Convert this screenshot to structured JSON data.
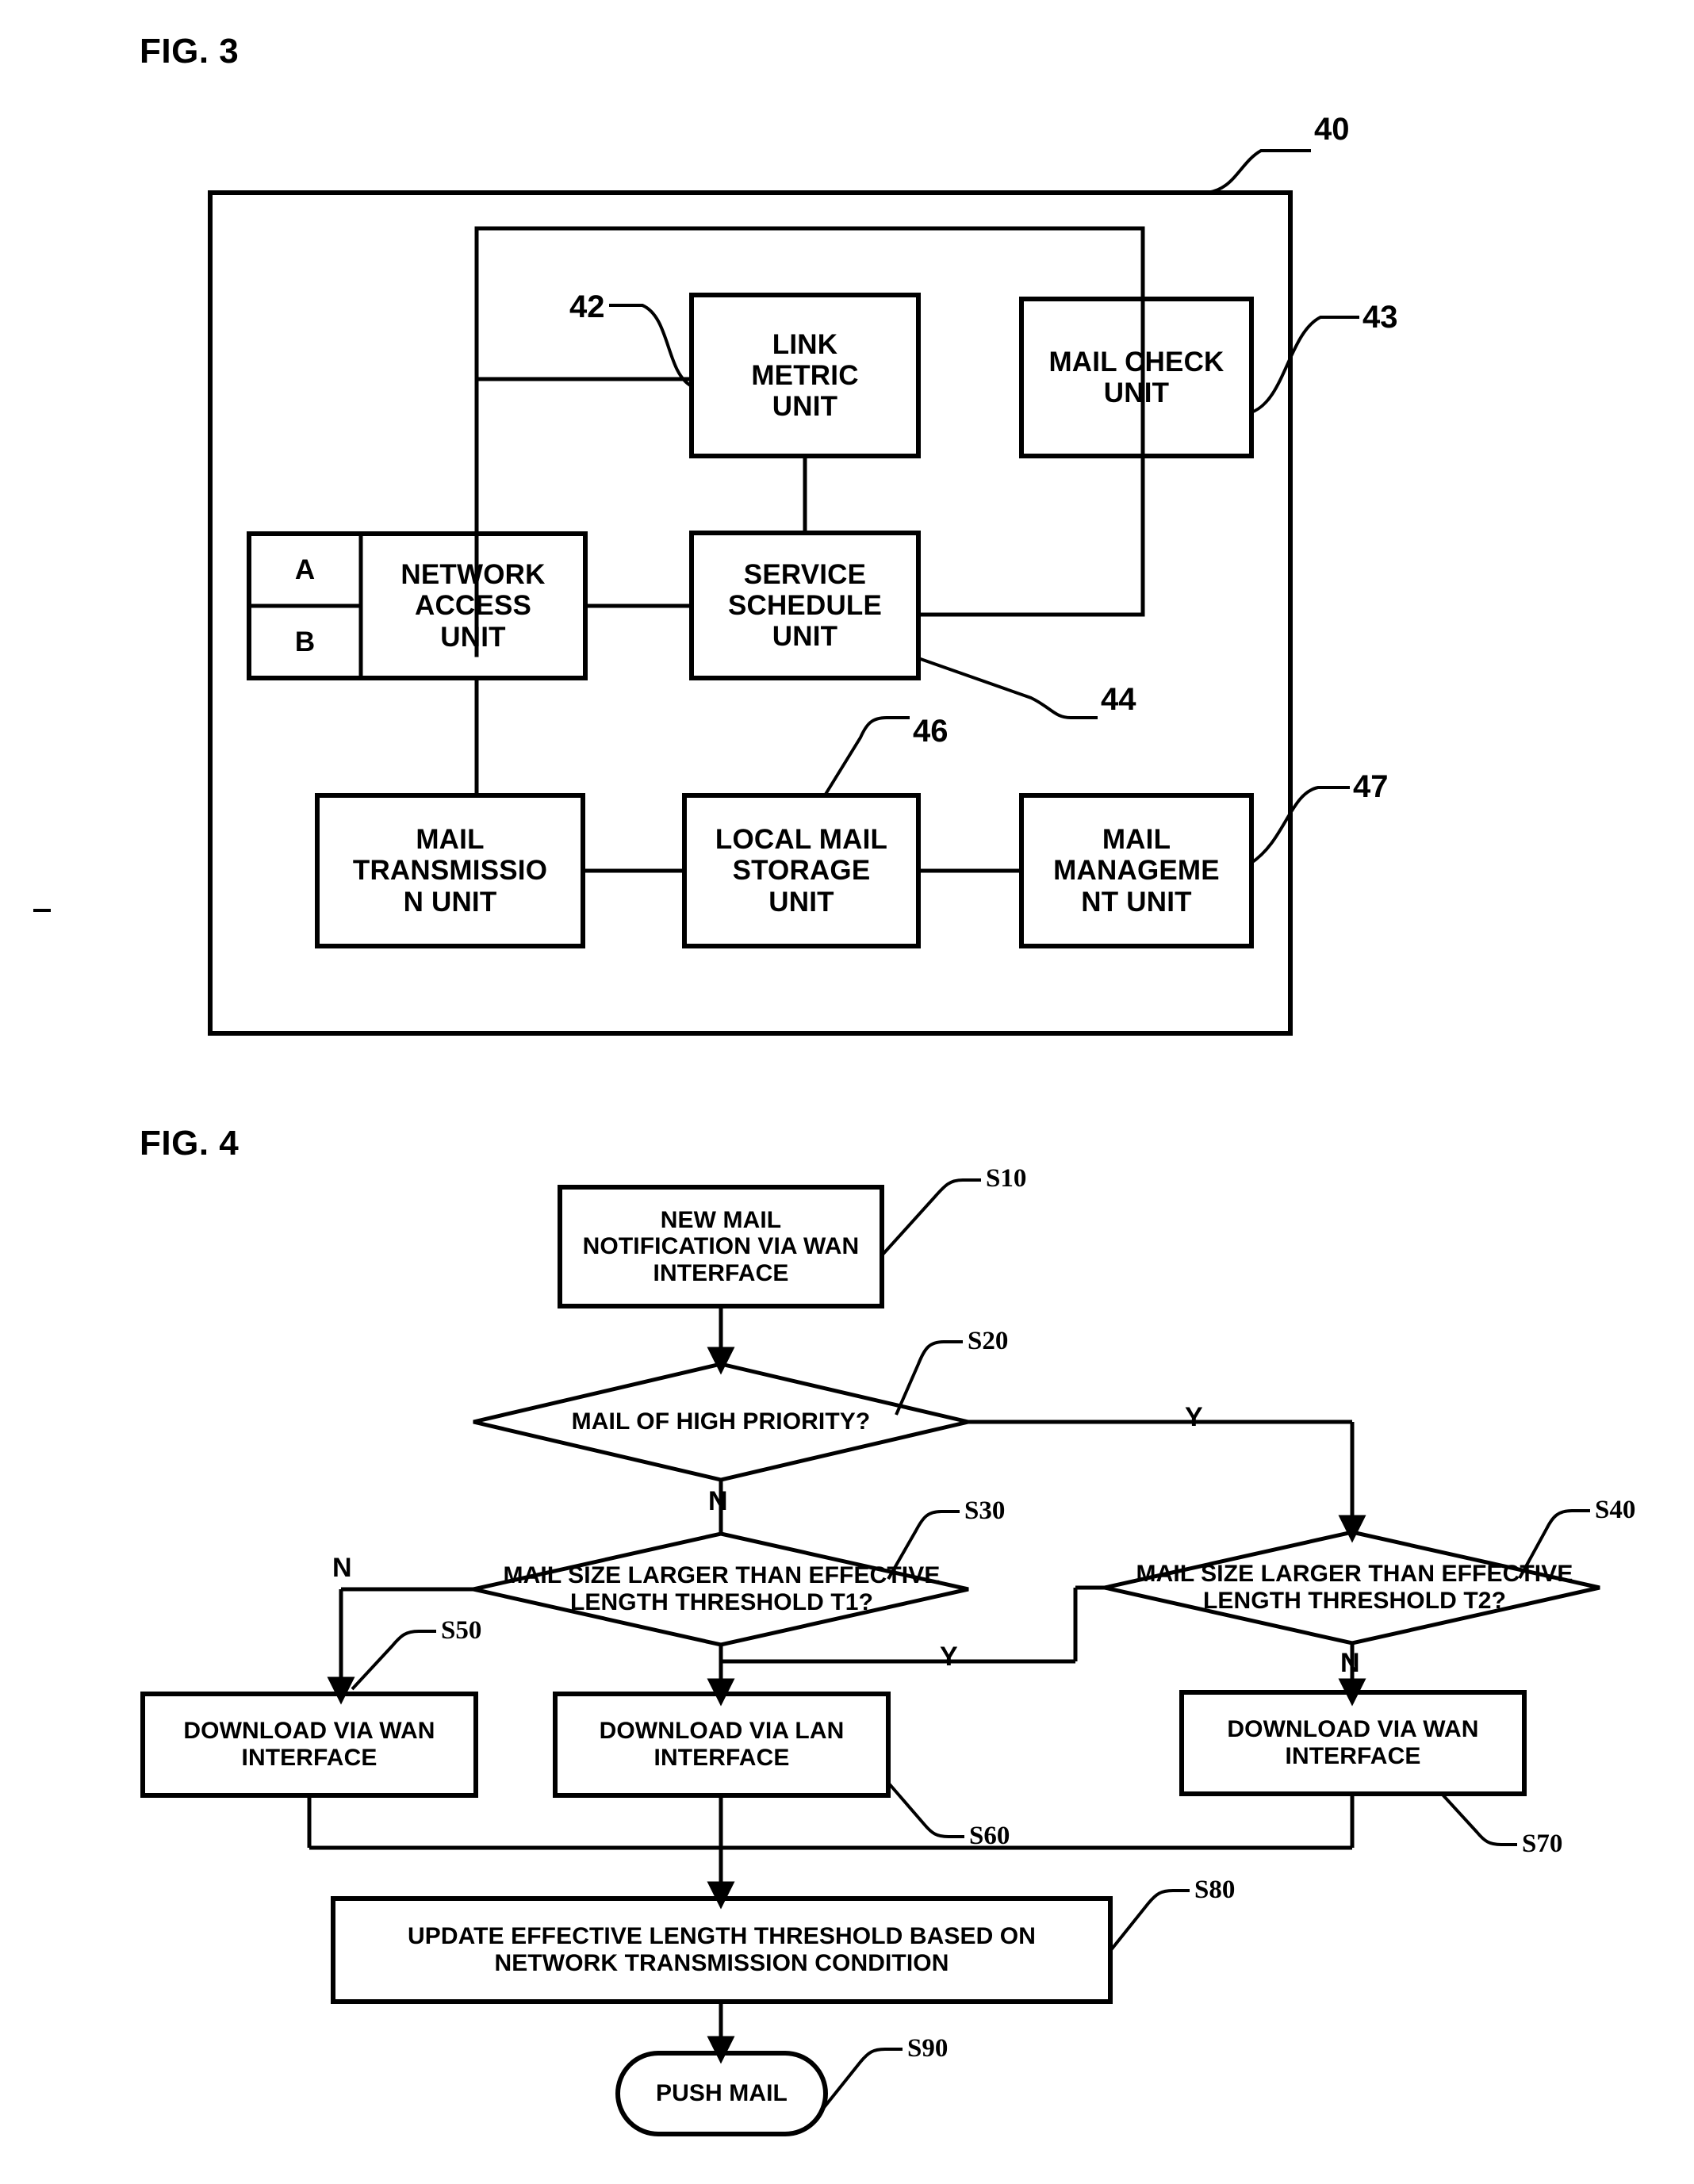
{
  "figures": {
    "fig3": {
      "title": "FIG. 3",
      "outer_ref": "40",
      "blocks": {
        "link_metric": "LINK\nMETRIC\nUNIT",
        "link_metric_ref": "42",
        "mail_check": "MAIL CHECK\nUNIT",
        "mail_check_ref": "43",
        "port_a": "A",
        "port_b": "B",
        "network_access": "NETWORK\nACCESS\nUNIT",
        "service_schedule": "SERVICE\nSCHEDULE\nUNIT",
        "service_schedule_ref": "44",
        "mail_transmission": "MAIL\nTRANSMISSIO\nN UNIT",
        "local_mail_storage": "LOCAL MAIL\nSTORAGE\nUNIT",
        "local_mail_storage_ref": "46",
        "mail_management": "MAIL\nMANAGEME\nNT UNIT",
        "mail_management_ref": "47"
      }
    },
    "fig4": {
      "title": "FIG. 4",
      "steps": {
        "s10": {
          "ref": "S10",
          "text": "NEW MAIL\nNOTIFICATION VIA WAN\nINTERFACE"
        },
        "s20": {
          "ref": "S20",
          "text": "MAIL OF HIGH PRIORITY?"
        },
        "s30": {
          "ref": "S30",
          "text": "MAIL SIZE LARGER THAN EFFECTIVE\nLENGTH THRESHOLD T1?"
        },
        "s40": {
          "ref": "S40",
          "text": "MAIL SIZE LARGER THAN EFFECTIVE\nLENGTH THRESHOLD T2?"
        },
        "s50": {
          "ref": "S50",
          "text": "DOWNLOAD VIA WAN\nINTERFACE"
        },
        "s60": {
          "ref": "S60",
          "text": "DOWNLOAD VIA LAN\nINTERFACE"
        },
        "s70": {
          "ref": "S70",
          "text": "DOWNLOAD VIA WAN\nINTERFACE"
        },
        "s80": {
          "ref": "S80",
          "text": "UPDATE EFFECTIVE LENGTH THRESHOLD BASED ON\nNETWORK TRANSMISSION CONDITION"
        },
        "s90": {
          "ref": "S90",
          "text": "PUSH MAIL"
        }
      },
      "branches": {
        "s20_yes": "Y",
        "s20_no": "N",
        "s30_no": "N",
        "s30_yes": "Y",
        "s40_yes": "Y",
        "s40_no": "N"
      }
    }
  },
  "colors": {
    "ink": "#000000",
    "paper": "#ffffff"
  }
}
